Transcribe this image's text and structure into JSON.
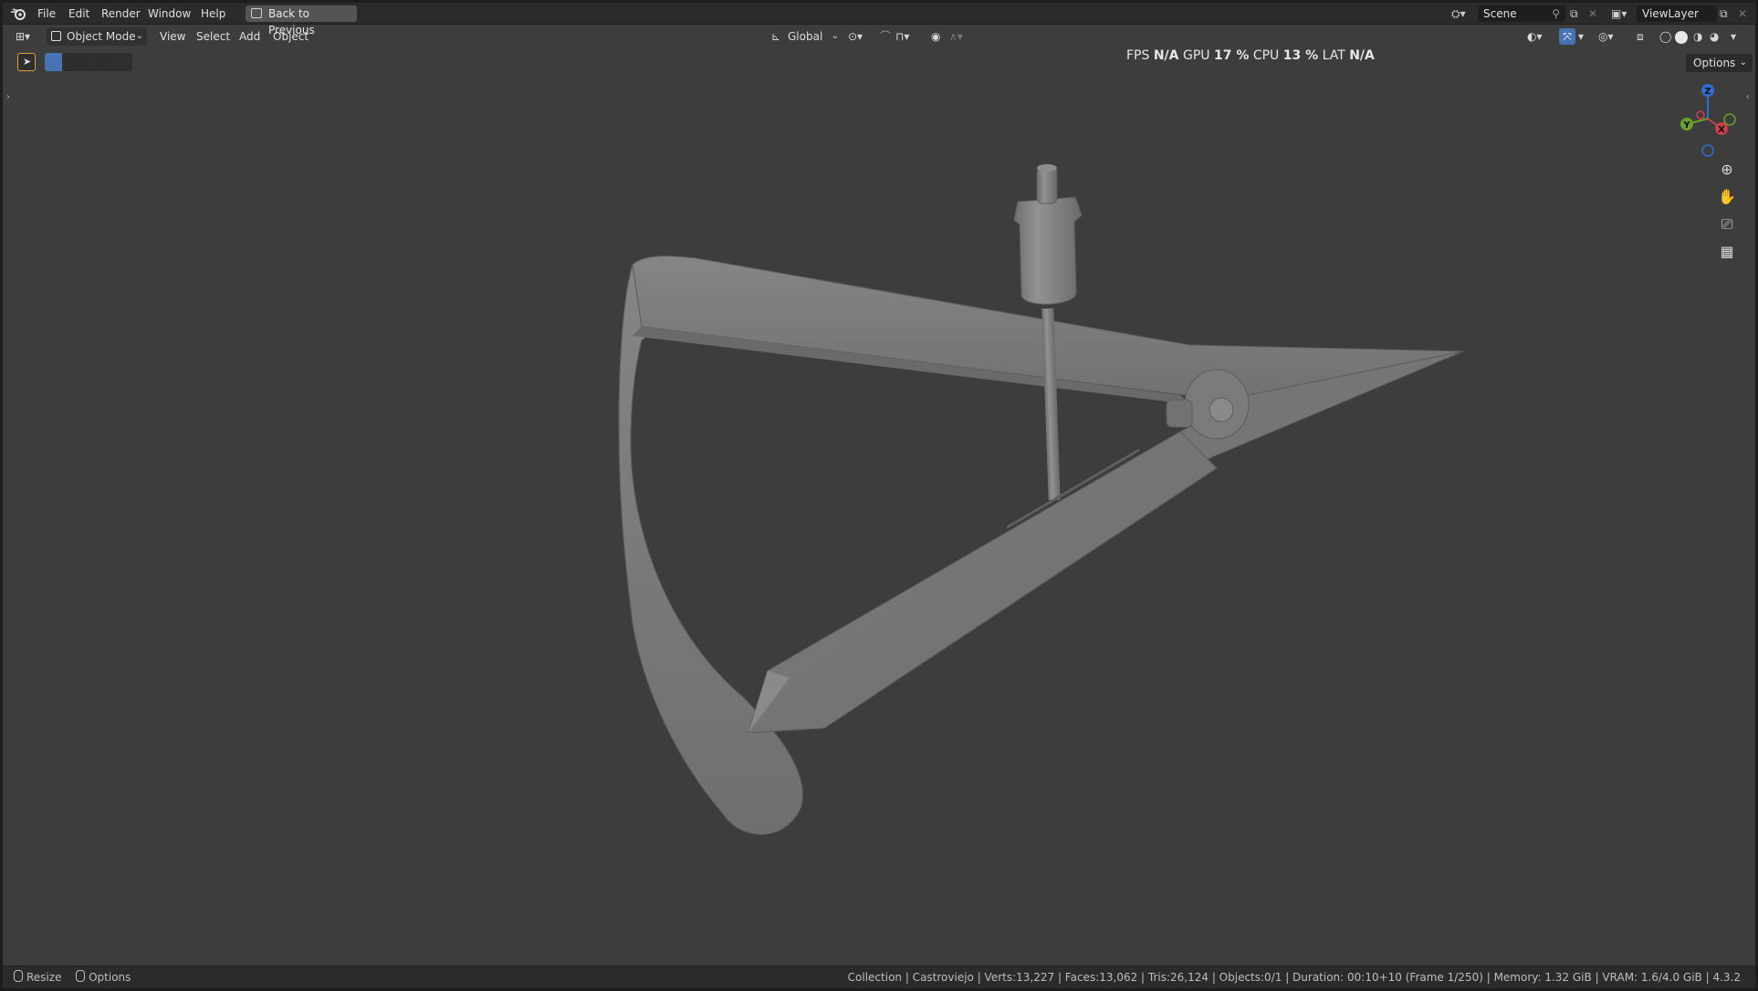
{
  "topbar": {
    "menus": [
      "File",
      "Edit",
      "Render",
      "Window",
      "Help"
    ],
    "back_button": "Back to Previous",
    "scene_label": "Scene",
    "viewlayer_label": "ViewLayer"
  },
  "header": {
    "mode": "Object Mode",
    "menus": [
      "View",
      "Select",
      "Add",
      "Object"
    ],
    "orientation": "Global"
  },
  "stats": {
    "fps_label": "FPS",
    "fps_value": "N/A",
    "gpu_label": "GPU",
    "gpu_value": "17 %",
    "cpu_label": "CPU",
    "cpu_value": "13 %",
    "lat_label": "LAT",
    "lat_value": "N/A"
  },
  "viewport": {
    "options_label": "Options",
    "gizmo_axes": [
      "Z",
      "Y",
      "X"
    ],
    "nav_icons": [
      "zoom-icon",
      "pan-hand-icon",
      "camera-icon",
      "grid-ortho-icon"
    ],
    "background_color": "#3d3d3d",
    "object_color": "#7a7a7a"
  },
  "statusbar": {
    "left_items": [
      "Resize",
      "Options"
    ],
    "info": "Collection | Castroviejo | Verts:13,227 | Faces:13,062 | Tris:26,124 | Objects:0/1 | Duration: 00:10+10 (Frame 1/250) | Memory: 1.32 GiB | VRAM: 1.6/4.0 GiB | 4.3.2"
  }
}
